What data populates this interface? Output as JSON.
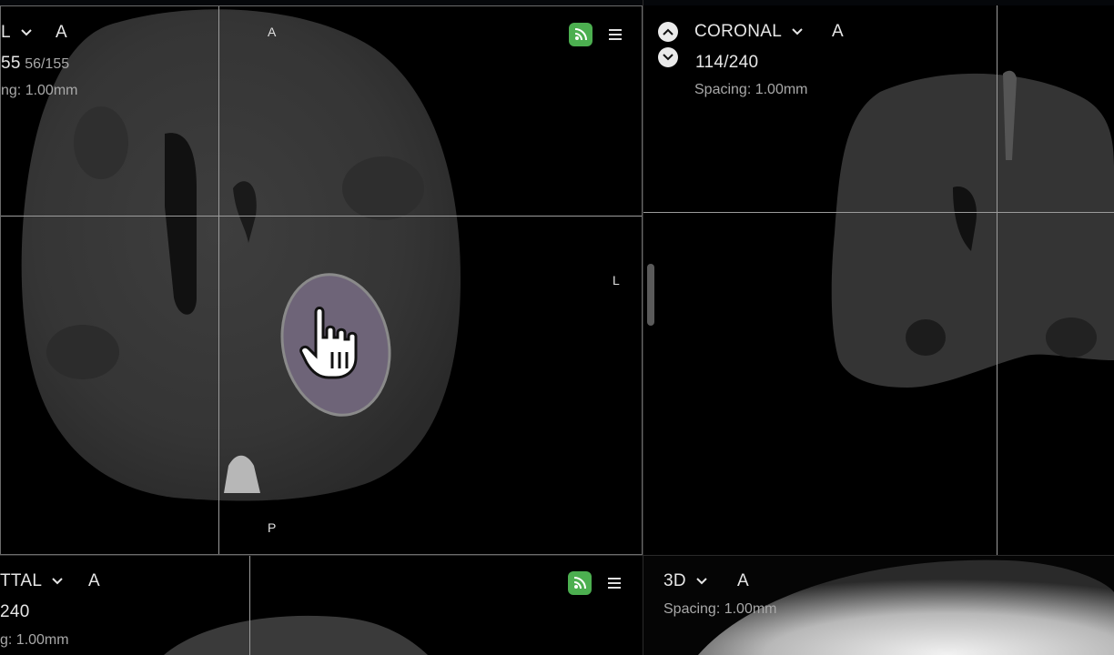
{
  "axial": {
    "view_label": "L",
    "slice": "55",
    "slice_of": "56/155",
    "spacing": "ng: 1.00mm",
    "orient_top": "A",
    "orient_right": "L",
    "orient_bottom": "P",
    "a_button": "A",
    "sync_icon": "rss-sync-icon",
    "menu_icon": "hamburger-menu-icon"
  },
  "coronal": {
    "view_label": "CORONAL",
    "slice": "114/240",
    "spacing": "Spacing: 1.00mm",
    "a_button": "A"
  },
  "sagittal": {
    "view_label": "TTAL",
    "slice": "240",
    "spacing": "g: 1.00mm",
    "a_button": "A"
  },
  "three_d": {
    "view_label": "3D",
    "spacing": "Spacing: 1.00mm",
    "a_button": "A"
  },
  "colors": {
    "accent_green": "#4caf50",
    "crosshair": "#9c9c9c",
    "lesion": "#6e6478"
  }
}
